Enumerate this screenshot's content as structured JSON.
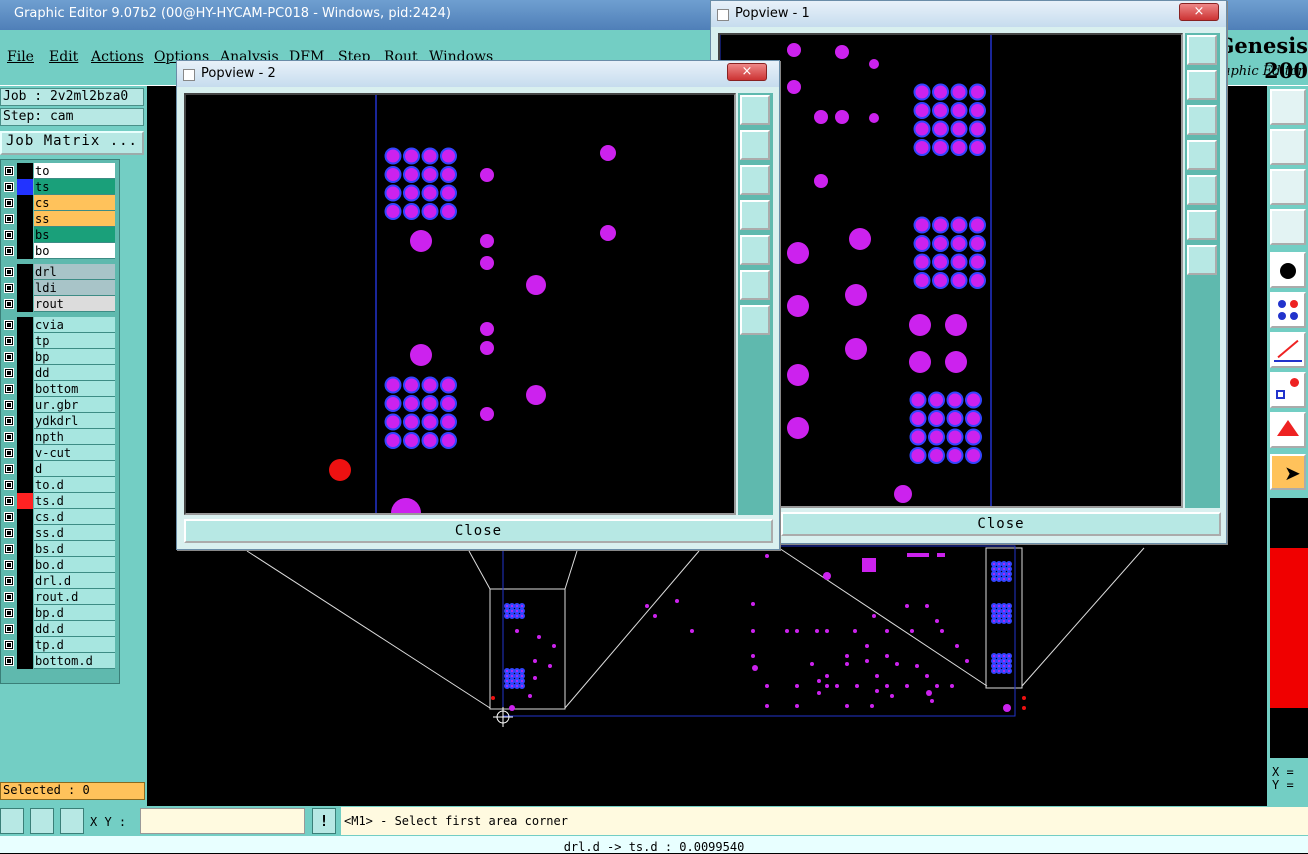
{
  "app": {
    "title": "Graphic Editor 9.07b2 (00@HY-HYCAM-PC018 - Windows, pid:2424)"
  },
  "menu": [
    "File",
    "Edit",
    "Actions",
    "Options",
    "Analysis",
    "DFM",
    "Step",
    "Rout",
    "Windows"
  ],
  "brand": {
    "name": "Genesis 200",
    "sub": "Graphic Editor"
  },
  "job": {
    "label": "Job : 2v2ml2bza0",
    "step": "Step: cam",
    "matrix_button": "Job Matrix ..."
  },
  "layers": [
    {
      "name": "to",
      "color": "#ffffff",
      "swatch": "#000000"
    },
    {
      "name": "ts",
      "color": "#1aa07a",
      "swatch": "#2233ff"
    },
    {
      "name": "cs",
      "color": "#ffc25b",
      "swatch": "#000000"
    },
    {
      "name": "ss",
      "color": "#ffc25b",
      "swatch": "#000000"
    },
    {
      "name": "bs",
      "color": "#1aa07a",
      "swatch": "#000000"
    },
    {
      "name": "bo",
      "color": "#ffffff",
      "swatch": "#000000"
    },
    {
      "name": "drl",
      "color": "#a8c4c8",
      "swatch": "#000000"
    },
    {
      "name": "ldi",
      "color": "#a8c4c8",
      "swatch": "#000000"
    },
    {
      "name": "rout",
      "color": "#dcdcdc",
      "swatch": "#000000"
    },
    {
      "name": "cvia",
      "color": "#a7e6e0",
      "swatch": "#000000"
    },
    {
      "name": "tp",
      "color": "#a7e6e0",
      "swatch": "#000000"
    },
    {
      "name": "bp",
      "color": "#a7e6e0",
      "swatch": "#000000"
    },
    {
      "name": "dd",
      "color": "#a7e6e0",
      "swatch": "#000000"
    },
    {
      "name": "bottom",
      "color": "#a7e6e0",
      "swatch": "#000000"
    },
    {
      "name": "ur.gbr",
      "color": "#a7e6e0",
      "swatch": "#000000"
    },
    {
      "name": "ydkdrl",
      "color": "#a7e6e0",
      "swatch": "#000000"
    },
    {
      "name": "npth",
      "color": "#a7e6e0",
      "swatch": "#000000"
    },
    {
      "name": "v-cut",
      "color": "#a7e6e0",
      "swatch": "#000000"
    },
    {
      "name": "d",
      "color": "#a7e6e0",
      "swatch": "#000000"
    },
    {
      "name": "to.d",
      "color": "#a7e6e0",
      "swatch": "#000000"
    },
    {
      "name": "ts.d",
      "color": "#a7e6e0",
      "swatch": "#ff2222"
    },
    {
      "name": "cs.d",
      "color": "#a7e6e0",
      "swatch": "#000000"
    },
    {
      "name": "ss.d",
      "color": "#a7e6e0",
      "swatch": "#000000"
    },
    {
      "name": "bs.d",
      "color": "#a7e6e0",
      "swatch": "#000000"
    },
    {
      "name": "bo.d",
      "color": "#a7e6e0",
      "swatch": "#000000"
    },
    {
      "name": "drl.d",
      "color": "#a7e6e0",
      "swatch": "#000000"
    },
    {
      "name": "rout.d",
      "color": "#a7e6e0",
      "swatch": "#000000"
    },
    {
      "name": "bp.d",
      "color": "#a7e6e0",
      "swatch": "#000000"
    },
    {
      "name": "dd.d",
      "color": "#a7e6e0",
      "swatch": "#000000"
    },
    {
      "name": "tp.d",
      "color": "#a7e6e0",
      "swatch": "#000000"
    },
    {
      "name": "bottom.d",
      "color": "#a7e6e0",
      "swatch": "#000000"
    }
  ],
  "selected": "Selected : 0",
  "status": {
    "xy_label": "X Y :",
    "xy_value": "",
    "prompt": "<M1> - Select first area corner",
    "bottom": "drl.d -> ts.d : 0.0099540"
  },
  "coords": {
    "x": "X =",
    "y": "Y ="
  },
  "popview1": {
    "title": "Popview - 1",
    "close": "Close",
    "x": "×"
  },
  "popview2": {
    "title": "Popview - 2",
    "close": "Close",
    "x": "×"
  }
}
